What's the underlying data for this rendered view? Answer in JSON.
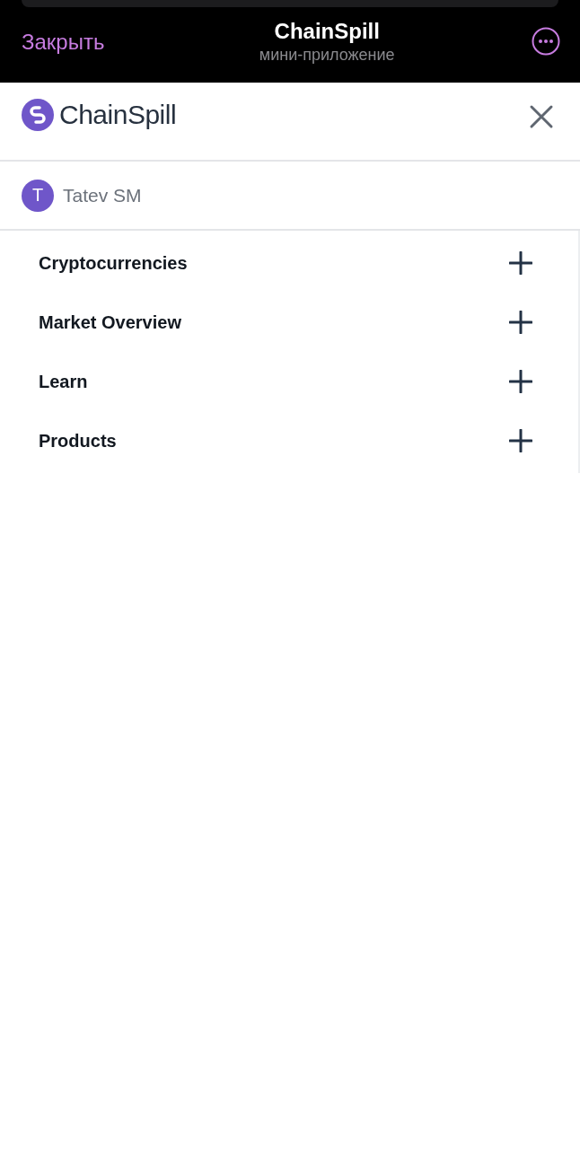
{
  "top_bar": {
    "close_label": "Закрыть",
    "title": "ChainSpill",
    "subtitle": "мини-приложение"
  },
  "menu_header": {
    "logo_text": "ChainSpill"
  },
  "user": {
    "initial": "T",
    "name": "Tatev SM"
  },
  "menu_items": [
    {
      "label": "Cryptocurrencies",
      "expanded": false
    },
    {
      "label": "Market Overview",
      "expanded": false
    },
    {
      "label": "Learn",
      "expanded": false
    },
    {
      "label": "Products",
      "expanded": false
    }
  ]
}
